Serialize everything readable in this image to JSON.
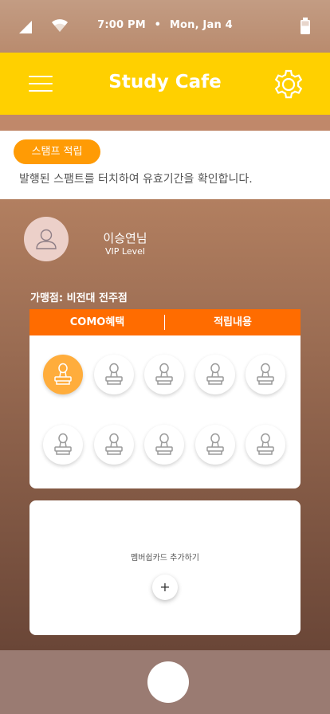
{
  "status_bar": {
    "time": "7:00 PM",
    "separator": "•",
    "date": "Mon, Jan 4",
    "icons": [
      "cellular-signal-icon",
      "wifi-icon",
      "battery-icon"
    ]
  },
  "app_bar": {
    "title": "Study Cafe",
    "menu_icon": "hamburger-menu-icon",
    "settings_icon": "gear-icon",
    "background_color": "#ffd000"
  },
  "stamp_info": {
    "badge_label": "스탬프 적립",
    "description": "발행된 스팸트를 터치하여 유효기간을 확인합니다.",
    "badge_color": "#ff9b05"
  },
  "user": {
    "name": "이승연님",
    "level": "VIP Level",
    "avatar_icon": "user-avatar-icon"
  },
  "store": {
    "label": "가맹점: 비전대 전주점"
  },
  "tabs": [
    {
      "label": "COMO혜택"
    },
    {
      "label": "적립내용"
    }
  ],
  "tab_color": "#ff6c00",
  "stamps": {
    "collected": 1,
    "total": 10,
    "icon": "stamp-icon",
    "active_color": "#ffad3c"
  },
  "membership_card": {
    "add_label": "멤버쉽카드 추가하기",
    "add_button_label": "+"
  },
  "bottom_bar": {
    "home_button_icon": "home-button-icon"
  }
}
